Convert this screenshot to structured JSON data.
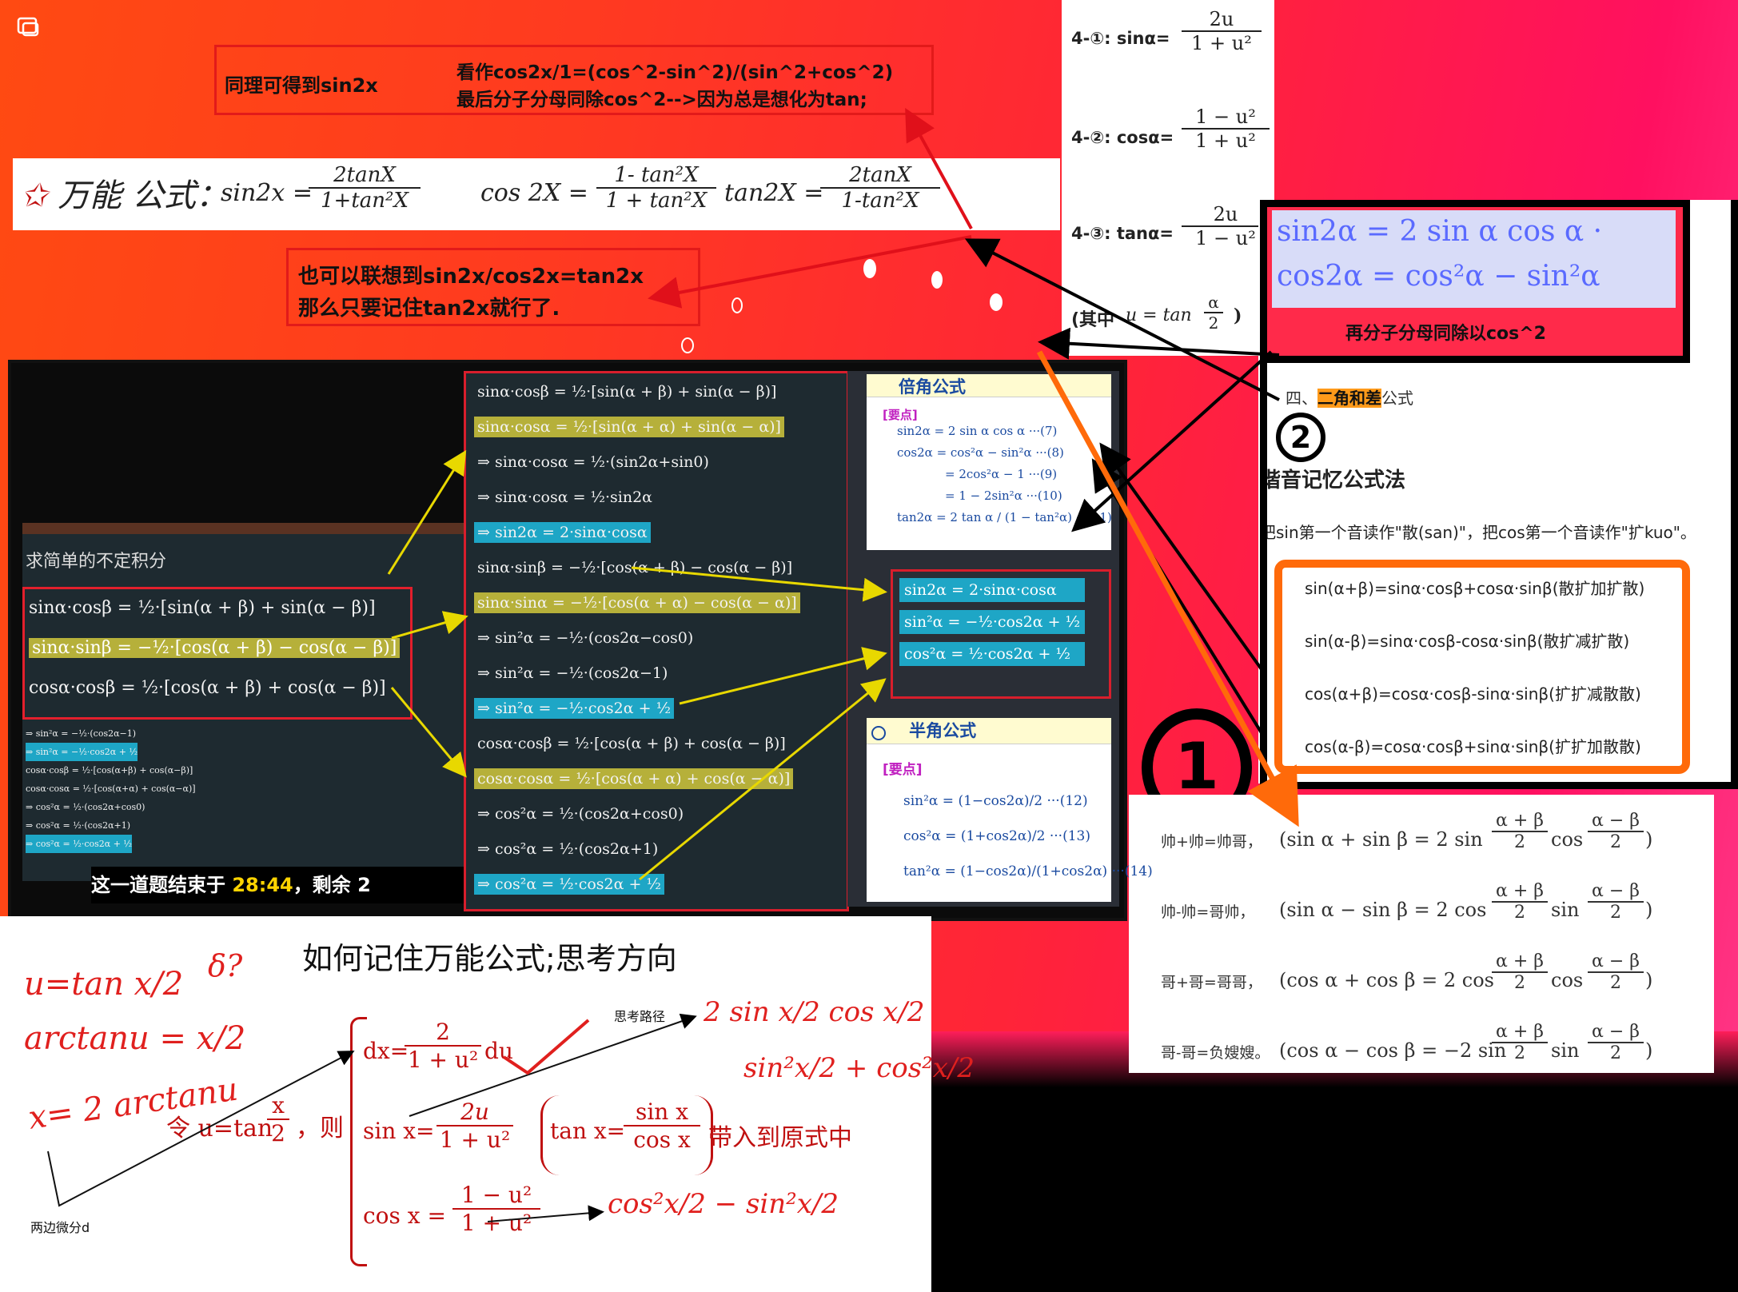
{
  "top_notes": {
    "same_for_sin": "同理可得到sin2x",
    "view_as_line1": "看作cos2x/1=(cos^2-sin^2)/(sin^2+cos^2)",
    "view_as_line2": "最后分子分母同除cos^2-->因为总是想化为tan;",
    "also_line1": "也可以联想到sin2x/cos2x=tan2x",
    "also_line2": "那么只要记住tan2x就行了."
  },
  "handwritten_banner": {
    "title": "万能 公式：",
    "sin2x": "sin2x",
    "sin_num": "2tanX",
    "sin_den": "1+tan²X",
    "cos2x": "cos 2X",
    "cos_num": "1- tan²X",
    "cos_den": "1 + tan²X",
    "tan2x": "tan2X",
    "tan_num": "2tanX",
    "tan_den": "1-tan²X"
  },
  "universal_panel": {
    "r1_label": "4-①: sinα=",
    "r1_num": "2u",
    "r1_den": "1 + u²",
    "r2_label": "4-②: cosα=",
    "r2_num": "1 − u²",
    "r2_den": "1 + u²",
    "r3_label": "4-③: tanα=",
    "r3_num": "2u",
    "r3_den": "1 − u²",
    "where": "(其中",
    "where_u": "u = tan",
    "where_num": "α",
    "where_den": "2",
    "where_close": ")"
  },
  "right_top_box": {
    "line1": "sin2α = 2 sin α cos α ·",
    "line2": "cos2α = cos²α − sin²α",
    "caption": "再分子分母同除以cos^2"
  },
  "sum_diff_panel": {
    "heading_prefix": "四、",
    "heading_hl": "二角和差",
    "heading_suffix": "公式",
    "circle_num": "2",
    "method": "谐音记忆公式法",
    "desc": "把sin第一个音读作\"散(san)\"，把cos第一个音读作\"扩kuo\"。",
    "items": [
      "sin(α+β)=sinα·cosβ+cosα·sinβ(散扩加扩散)",
      "sin(α-β)=sinα·cosβ-cosα·sinβ(散扩减扩散)",
      "cos(α+β)=cosα·cosβ-sinα·sinβ(扩扩减散散)",
      "cos(α-β)=cosα·cosβ+sinα·sinβ(扩扩加散散)"
    ]
  },
  "circle_one": "1",
  "sum_to_product": [
    {
      "label": "帅+帅=帅哥，",
      "formula": "(sin α + sin β = 2 sin",
      "f1n": "α + β",
      "f1d": "2",
      "mid": "cos",
      "f2n": "α − β",
      "f2d": "2",
      "end": ")"
    },
    {
      "label": "帅-帅=哥帅，",
      "formula": "(sin α − sin β = 2 cos",
      "f1n": "α + β",
      "f1d": "2",
      "mid": "sin",
      "f2n": "α − β",
      "f2d": "2",
      "end": ")"
    },
    {
      "label": "哥+哥=哥哥，",
      "formula": "(cos α + cos β = 2 cos",
      "f1n": "α + β",
      "f1d": "2",
      "mid": "cos",
      "f2n": "α − β",
      "f2d": "2",
      "end": ")"
    },
    {
      "label": "哥-哥=负嫂嫂。",
      "formula": "(cos α − cos β = −2 sin",
      "f1n": "α + β",
      "f1d": "2",
      "mid": "sin",
      "f2n": "α − β",
      "f2d": "2",
      "end": ")"
    }
  ],
  "video": {
    "board_title": "求简单的不定积分",
    "board_left_rows": [
      "sinα·cosβ = ½·[sin(α + β) + sin(α − β)]",
      "sinα·sinβ = −½·[cos(α + β) − cos(α − β)]",
      "cosα·cosβ = ½·[cos(α + β) + cos(α − β)]"
    ],
    "board_small_rows": [
      "⇒ sin²α = −½·(cos2α−1)",
      "⇒ sin²α = −½·cos2α + ½",
      "cosα·cosβ = ½·[cos(α+β) + cos(α−β)]",
      "cosα·cosα = ½·[cos(α+α) + cos(α−α)]",
      "⇒ cos²α = ½·(cos2α+cos0)",
      "⇒ cos²α = ½·(cos2α+1)",
      "⇒ cos²α = ½·cos2α + ½"
    ],
    "subtitle": "这一道题结束于",
    "time": "28:44",
    "subtitle_tail": "，剩余 2",
    "mid_rows": [
      {
        "text": "sinα·cosβ = ½·[sin(α + β) + sin(α − β)]",
        "hl": ""
      },
      {
        "text": "sinα·cosα = ½·[sin(α + α) + sin(α − α)]",
        "hl": "y"
      },
      {
        "text": "⇒ sinα·cosα = ½·(sin2α+sin0)",
        "hl": ""
      },
      {
        "text": "⇒ sinα·cosα = ½·sin2α",
        "hl": ""
      },
      {
        "text": "⇒ sin2α = 2·sinα·cosα",
        "hl": "b"
      },
      {
        "text": "sinα·sinβ = −½·[cos(α + β) − cos(α − β)]",
        "hl": ""
      },
      {
        "text": "sinα·sinα = −½·[cos(α + α) − cos(α − α)]",
        "hl": "y"
      },
      {
        "text": "⇒ sin²α = −½·(cos2α−cos0)",
        "hl": ""
      },
      {
        "text": "⇒ sin²α = −½·(cos2α−1)",
        "hl": ""
      },
      {
        "text": "⇒ sin²α = −½·cos2α + ½",
        "hl": "b"
      },
      {
        "text": "cosα·cosβ = ½·[cos(α + β) + cos(α − β)]",
        "hl": ""
      },
      {
        "text": "cosα·cosα = ½·[cos(α + α) + cos(α − α)]",
        "hl": "y"
      },
      {
        "text": "⇒ cos²α = ½·(cos2α+cos0)",
        "hl": ""
      },
      {
        "text": "⇒ cos²α = ½·(cos2α+1)",
        "hl": ""
      },
      {
        "text": "⇒ cos²α = ½·cos2α + ½",
        "hl": "b"
      }
    ],
    "double_title": "倍角公式",
    "key_label": "[要点]",
    "double_rows": [
      "sin2α = 2 sin α cos α ···(7)",
      "cos2α = cos²α − sin²α ···(8)",
      "= 2cos²α − 1 ···(9)",
      "= 1 − 2sin²α ···(10)",
      "tan2α = 2 tan α / (1 − tan²α) ···(11)"
    ],
    "blue_rows": [
      "sin2α = 2·sinα·cosα",
      "sin²α = −½·cos2α + ½",
      "cos²α = ½·cos2α + ½"
    ],
    "half_title": "半角公式",
    "half_key": "[要点]",
    "half_rows": [
      "sin²α = (1−cos2α)/2 ···(12)",
      "cos²α = (1+cos2α)/2 ···(13)",
      "tan²α = (1−cos2α)/(1+cos2α) ···(14)"
    ]
  },
  "bottom_panel": {
    "title": "如何记住万能公式;思考方向",
    "hw_u": "u=tan x/2",
    "hw_q": "δ?",
    "hw_arctan": "arctanu = x/2",
    "hw_x": "x= 2 arctanu",
    "label_both": "两边微分d",
    "label_path": "思考路径",
    "let": "令 u=tan",
    "let_frac_n": "x",
    "let_frac_d": "2",
    "then": "，则",
    "dx_label": "dx=",
    "dx_num": "2",
    "dx_den": "1 + u²",
    "dx_du": "du",
    "sin_label": "sin x=",
    "sin_num": "2u",
    "sin_den": "1 + u²",
    "tan_label": "tan x=",
    "tan_num": "sin x",
    "tan_den": "cos x",
    "plug": "带入到原式中",
    "cos_label": "cos x =",
    "cos_num": "1 − u²",
    "cos_den": "1 + u²",
    "hw_right1": "2 sin x/2 cos x/2",
    "hw_right2": "sin²x/2 + cos²x/2",
    "hw_right3": "cos²x/2 − sin²x/2"
  }
}
